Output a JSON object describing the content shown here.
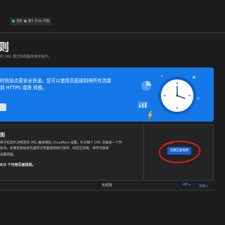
{
  "header": {
    "pills": [
      {
        "label": "活动",
        "dot_color": "#2fbf71"
      },
      {
        "label": "星号",
        "dot_color": "#9a9a9a"
      },
      {
        "label": "Free 计划",
        "dot_color": ""
      }
    ]
  },
  "page": {
    "title": "则",
    "subtitle": "的 URL 模式匹配触发某些操作。"
  },
  "promo": {
    "line1": "的快站点更安全快速。您可以使用页面规则将所有流量",
    "line2": "到 HTTPS 或将 转换。",
    "button_label": "",
    "accent_color": "#1478e8"
  },
  "rules_card": {
    "title": "则",
    "desc_line1": "用于指定针对特定的 URL 触发哪些 Cloudflare 设置。针对每个 URL 仅触发一个页",
    "desc_line2": "技术。如果您想按优先顺序对页面规则进行排序，则应在前用，请尽可能将",
    "desc_line3": "设置前面。",
    "count_text": "0/3 个可用页面规则。",
    "create_button": "创建页面规则"
  },
  "list": {
    "header": "无规则",
    "api_link": "API ▸",
    "help_link": "帮助 ▸"
  }
}
